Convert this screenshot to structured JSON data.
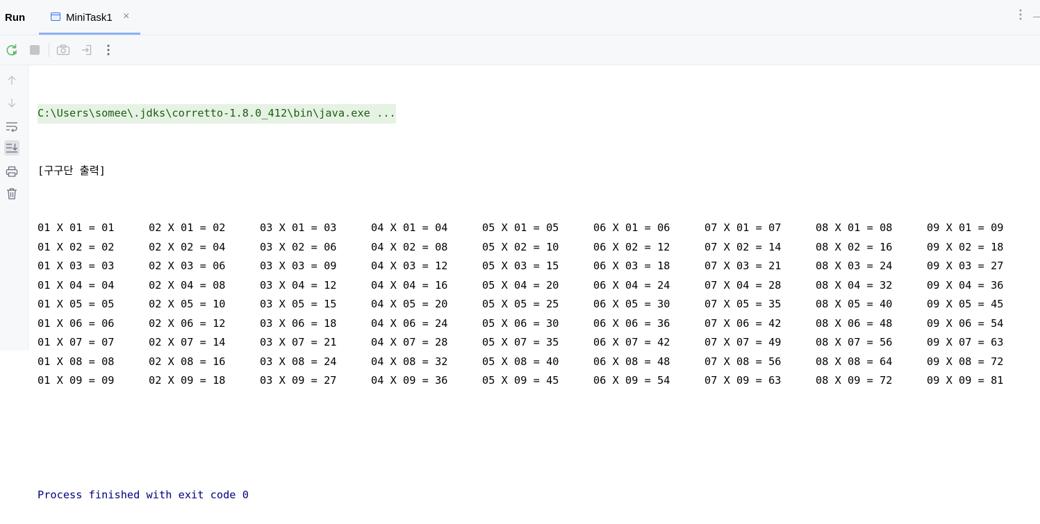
{
  "header": {
    "run_label": "Run",
    "tab_title": "MiniTask1",
    "tab_close": "×"
  },
  "toolbar": {
    "buttons": [
      "rerun-icon",
      "stop-icon",
      "camera-icon",
      "exit-icon",
      "more-vertical-icon"
    ]
  },
  "gutter": {
    "buttons": [
      "arrow-up-icon",
      "arrow-down-icon",
      "soft-wrap-icon",
      "scroll-to-end-icon",
      "print-icon",
      "trash-icon"
    ]
  },
  "console": {
    "command": "C:\\Users\\somee\\.jdks\\corretto-1.8.0_412\\bin\\java.exe ...",
    "heading": "[구구단 출력]",
    "rows": [
      [
        "01 X 01 = 01",
        "02 X 01 = 02",
        "03 X 01 = 03",
        "04 X 01 = 04",
        "05 X 01 = 05",
        "06 X 01 = 06",
        "07 X 01 = 07",
        "08 X 01 = 08",
        "09 X 01 = 09"
      ],
      [
        "01 X 02 = 02",
        "02 X 02 = 04",
        "03 X 02 = 06",
        "04 X 02 = 08",
        "05 X 02 = 10",
        "06 X 02 = 12",
        "07 X 02 = 14",
        "08 X 02 = 16",
        "09 X 02 = 18"
      ],
      [
        "01 X 03 = 03",
        "02 X 03 = 06",
        "03 X 03 = 09",
        "04 X 03 = 12",
        "05 X 03 = 15",
        "06 X 03 = 18",
        "07 X 03 = 21",
        "08 X 03 = 24",
        "09 X 03 = 27"
      ],
      [
        "01 X 04 = 04",
        "02 X 04 = 08",
        "03 X 04 = 12",
        "04 X 04 = 16",
        "05 X 04 = 20",
        "06 X 04 = 24",
        "07 X 04 = 28",
        "08 X 04 = 32",
        "09 X 04 = 36"
      ],
      [
        "01 X 05 = 05",
        "02 X 05 = 10",
        "03 X 05 = 15",
        "04 X 05 = 20",
        "05 X 05 = 25",
        "06 X 05 = 30",
        "07 X 05 = 35",
        "08 X 05 = 40",
        "09 X 05 = 45"
      ],
      [
        "01 X 06 = 06",
        "02 X 06 = 12",
        "03 X 06 = 18",
        "04 X 06 = 24",
        "05 X 06 = 30",
        "06 X 06 = 36",
        "07 X 06 = 42",
        "08 X 06 = 48",
        "09 X 06 = 54"
      ],
      [
        "01 X 07 = 07",
        "02 X 07 = 14",
        "03 X 07 = 21",
        "04 X 07 = 28",
        "05 X 07 = 35",
        "06 X 07 = 42",
        "07 X 07 = 49",
        "08 X 07 = 56",
        "09 X 07 = 63"
      ],
      [
        "01 X 08 = 08",
        "02 X 08 = 16",
        "03 X 08 = 24",
        "04 X 08 = 32",
        "05 X 08 = 40",
        "06 X 08 = 48",
        "07 X 08 = 56",
        "08 X 08 = 64",
        "09 X 08 = 72"
      ],
      [
        "01 X 09 = 09",
        "02 X 09 = 18",
        "03 X 09 = 27",
        "04 X 09 = 36",
        "05 X 09 = 45",
        "06 X 09 = 54",
        "07 X 09 = 63",
        "08 X 09 = 72",
        "09 X 09 = 81"
      ]
    ],
    "process_finished": "Process finished with exit code 0"
  },
  "colors": {
    "accent": "#3574f0",
    "command_bg": "#e6f2e3",
    "command_fg": "#1a5c12",
    "process_fg": "#000080",
    "rerun_green": "#5fb865"
  }
}
